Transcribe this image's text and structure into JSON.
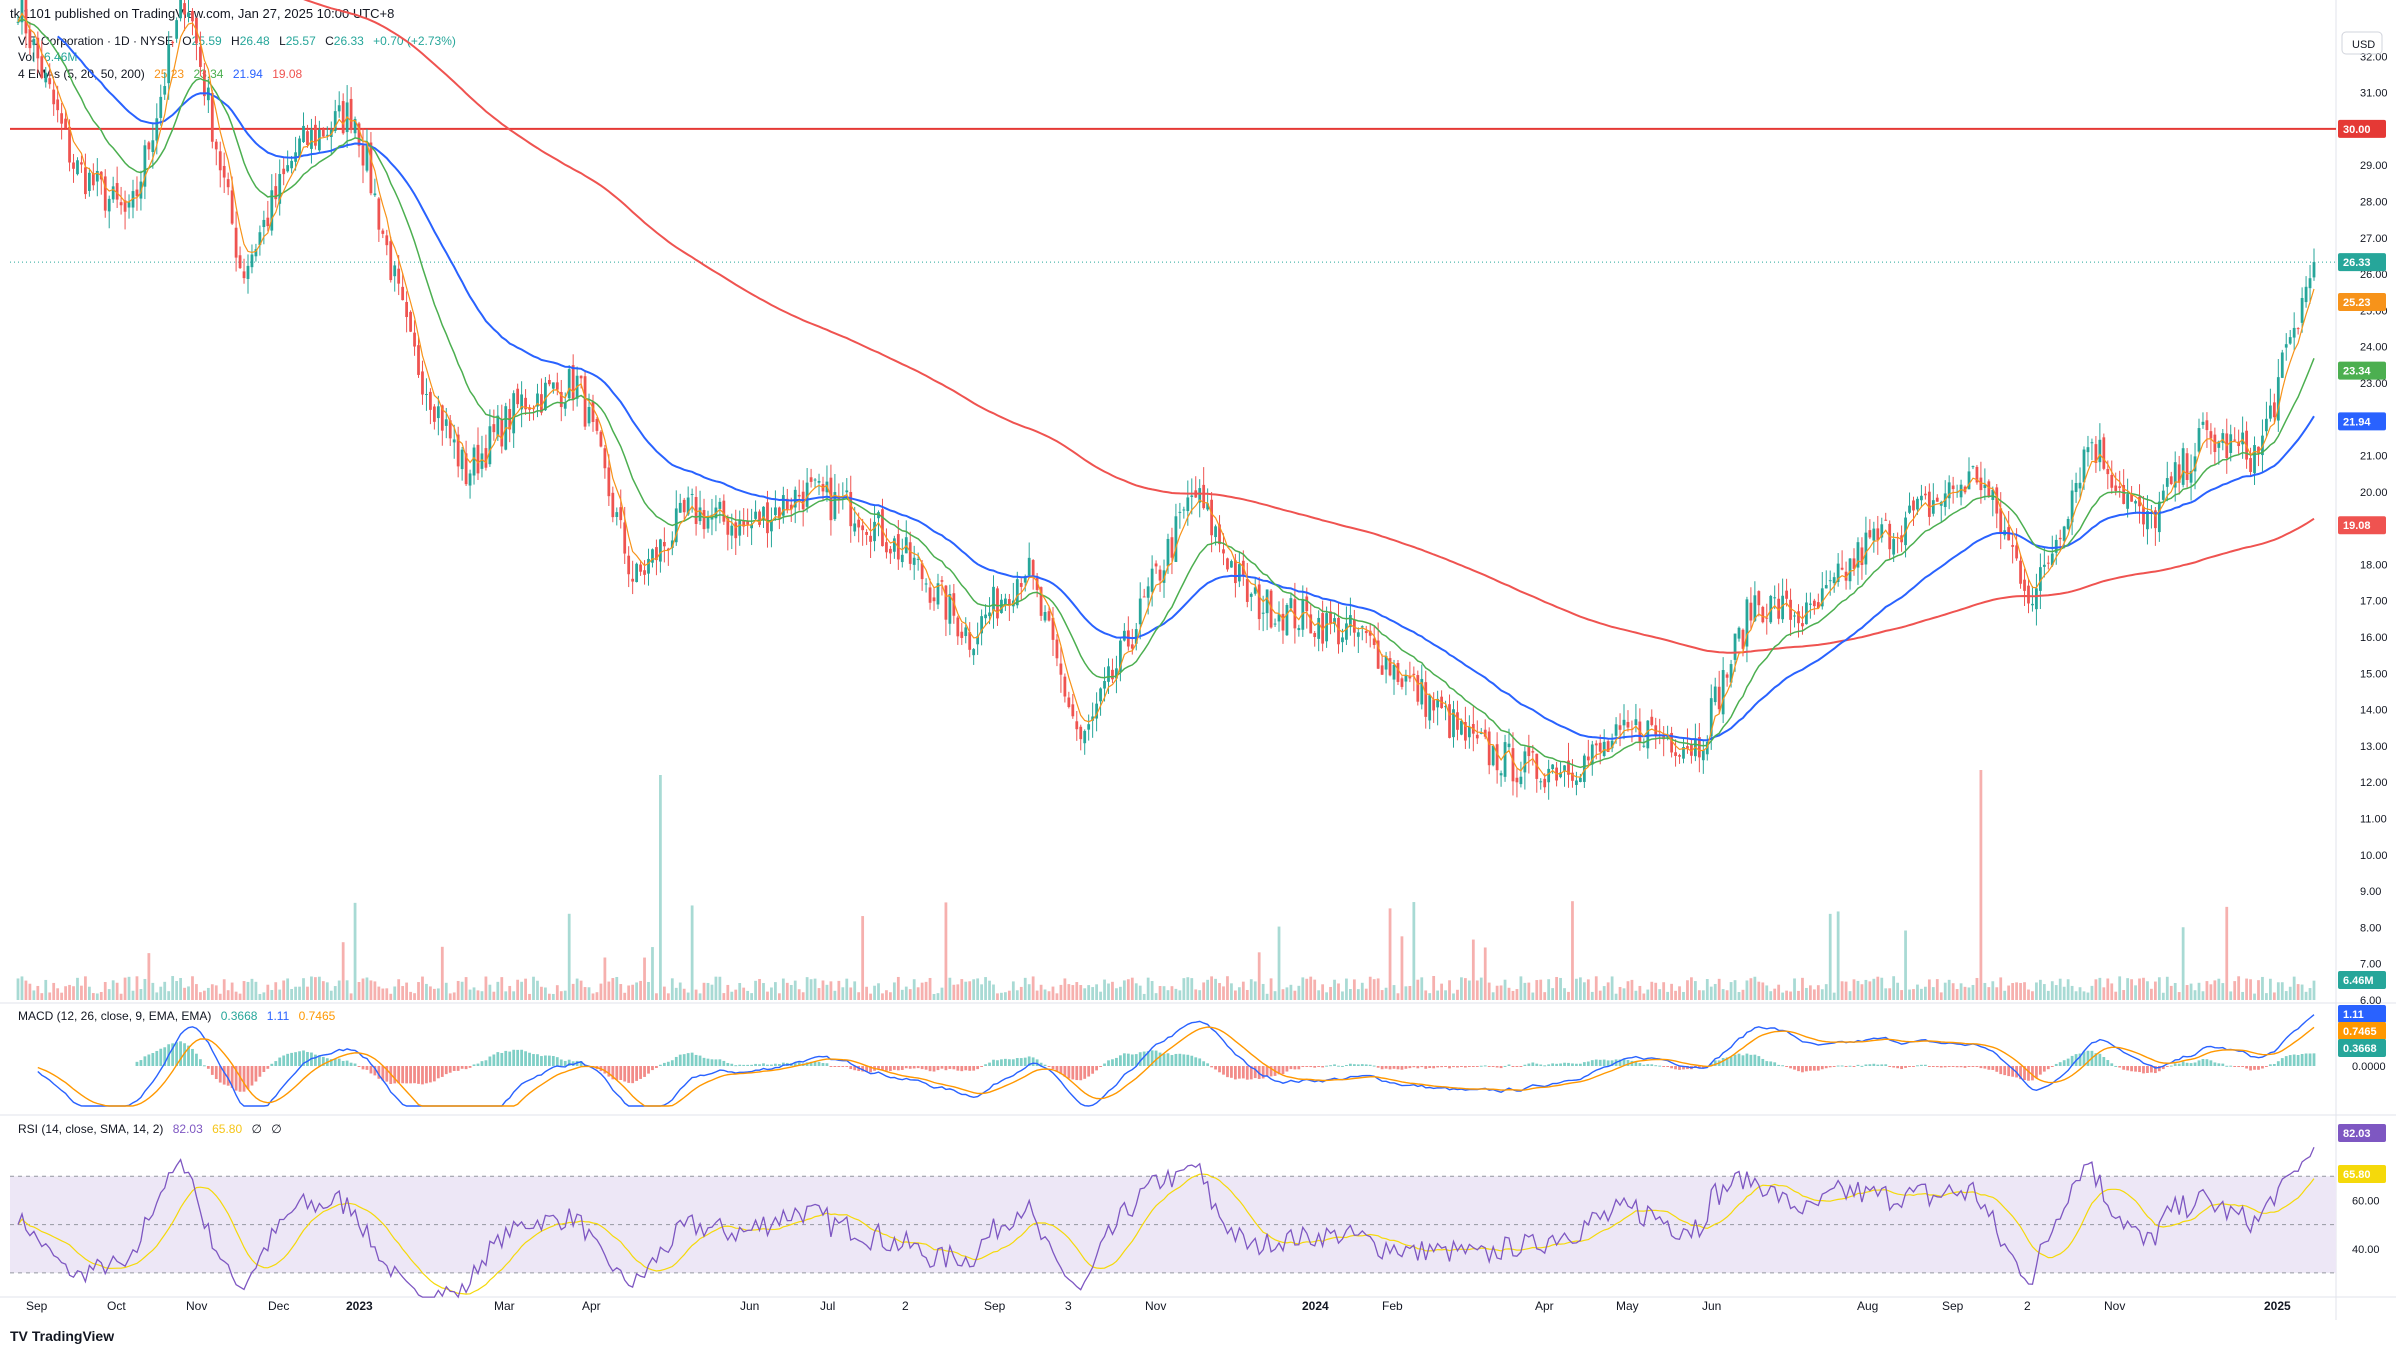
{
  "publisher_line": "tkj1101 published on TradingView.com, Jan 27, 2025 10:00 UTC+8",
  "footer": {
    "logo": "TV",
    "brand": "TradingView"
  },
  "colors": {
    "up": "#26a69a",
    "down": "#ef5350",
    "ema5": "#f7931a",
    "ema20": "#4caf50",
    "ema50": "#2962ff",
    "ema200": "#ef5350",
    "resistance": "#e53935",
    "macd": "#2962ff",
    "signal": "#ff9800",
    "rsi": "#7e57c2",
    "rsi_ma": "#f5d90a",
    "rsi_band": "#ede7f6"
  },
  "legend": {
    "symbol": "V.F. Corporation · 1D · NYSE",
    "o_label": "O",
    "o_val": "25.59",
    "h_label": "H",
    "h_val": "26.48",
    "l_label": "L",
    "l_val": "25.57",
    "c_label": "C",
    "c_val": "26.33",
    "change": "+0.70 (+2.73%)",
    "vol_label": "Vol",
    "vol_val": "6.46M",
    "ema_label": "4 EMAs (5, 20, 50, 200)",
    "ema_vals": [
      "25.23",
      "23.34",
      "21.94",
      "19.08"
    ],
    "macd_label": "MACD (12, 26, close, 9, EMA, EMA)",
    "macd_vals": [
      "0.3668",
      "1.11",
      "0.7465"
    ],
    "rsi_label": "RSI (14, close, SMA, 14, 2)",
    "rsi_vals": [
      "82.03",
      "65.80",
      "∅",
      "∅"
    ]
  },
  "price_axis": {
    "currency": "USD",
    "ticks": [
      "32.00",
      "31.00",
      "29.00",
      "28.00",
      "27.00",
      "26.00",
      "25.00",
      "24.00",
      "23.00",
      "21.00",
      "20.00",
      "18.00",
      "17.00",
      "16.00",
      "15.00",
      "14.00",
      "13.00",
      "12.00",
      "11.00",
      "10.00",
      "9.00",
      "8.00",
      "7.00",
      "6.00"
    ],
    "badges": [
      {
        "label": "30.00",
        "value": 30.0,
        "color": "#e53935"
      },
      {
        "label": "26.33",
        "value": 26.33,
        "color": "#26a69a"
      },
      {
        "label": "25.23",
        "value": 25.23,
        "color": "#f7931a"
      },
      {
        "label": "23.34",
        "value": 23.34,
        "color": "#4caf50"
      },
      {
        "label": "21.94",
        "value": 21.94,
        "color": "#2962ff"
      },
      {
        "label": "19.08",
        "value": 19.08,
        "color": "#ef5350"
      },
      {
        "label": "6.46M",
        "value": 6.2,
        "color": "#26a69a"
      }
    ]
  },
  "macd_axis": {
    "ticks": [
      "0.0000"
    ],
    "badges": [
      {
        "label": "1.11",
        "value": 1.11,
        "color": "#2962ff"
      },
      {
        "label": "0.7465",
        "value": 0.7465,
        "color": "#ff9800"
      },
      {
        "label": "0.3668",
        "value": 0.3668,
        "color": "#26a69a"
      }
    ]
  },
  "rsi_axis": {
    "ticks": [
      "60.00",
      "40.00"
    ],
    "badges": [
      {
        "label": "82.03",
        "value": 82.03,
        "color": "#7e57c2"
      },
      {
        "label": "65.80",
        "value": 65.8,
        "color": "#f5d90a"
      }
    ]
  },
  "time_axis": [
    "Sep",
    "Oct",
    "Nov",
    "Dec",
    "2023",
    "Mar",
    "Apr",
    "Jun",
    "Jul",
    "2",
    "Sep",
    "3",
    "Nov",
    "2024",
    "Feb",
    "Apr",
    "May",
    "Jun",
    "Aug",
    "Sep",
    "2",
    "Nov",
    "2025"
  ],
  "chart_data": {
    "type": "candlestick",
    "title": "V.F. Corporation · 1D · NYSE",
    "ylabel": "USD",
    "ylim": [
      6.0,
      33.0
    ],
    "resistance_level": 30.0,
    "last": {
      "open": 25.59,
      "high": 26.48,
      "low": 25.57,
      "close": 26.33,
      "change": 0.7,
      "change_pct": 2.73,
      "volume": "6.46M"
    },
    "close_path": [
      [
        "Sep",
        33.5
      ],
      [
        "Oct",
        29.0
      ],
      [
        "Nov",
        27.5
      ],
      [
        "Dec",
        33.8
      ],
      [
        "Dec",
        26.0
      ],
      [
        "2023",
        29.5
      ],
      [
        "2023",
        30.5
      ],
      [
        "Mar",
        24.0
      ],
      [
        "Mar",
        20.5
      ],
      [
        "Apr",
        22.5
      ],
      [
        "Apr",
        23.0
      ],
      [
        "Jun",
        17.5
      ],
      [
        "Jun",
        19.5
      ],
      [
        "Jul",
        19.0
      ],
      [
        "2",
        20.0
      ],
      [
        "Sep",
        19.5
      ],
      [
        "Sep",
        18.0
      ],
      [
        "3",
        16.0
      ],
      [
        "Nov",
        18.0
      ],
      [
        "Nov",
        13.0
      ],
      [
        "Nov",
        16.5
      ],
      [
        "Nov",
        20.0
      ],
      [
        "2024",
        17.0
      ],
      [
        "Feb",
        16.5
      ],
      [
        "Feb",
        16.0
      ],
      [
        "Apr",
        14.5
      ],
      [
        "Apr",
        13.0
      ],
      [
        "May",
        12.3
      ],
      [
        "May",
        12.6
      ],
      [
        "Jun",
        13.5
      ],
      [
        "Jun",
        13.0
      ],
      [
        "Aug",
        17.0
      ],
      [
        "Aug",
        16.5
      ],
      [
        "Sep",
        18.5
      ],
      [
        "2",
        19.5
      ],
      [
        "2",
        20.5
      ],
      [
        "Nov",
        17.0
      ],
      [
        "Nov",
        21.5
      ],
      [
        "Nov",
        19.0
      ],
      [
        "2025",
        21.5
      ],
      [
        "2025",
        21.0
      ],
      [
        "2025",
        26.33
      ]
    ],
    "series": [
      {
        "name": "EMA 5",
        "last": 25.23
      },
      {
        "name": "EMA 20",
        "last": 23.34
      },
      {
        "name": "EMA 50",
        "last": 21.94
      },
      {
        "name": "EMA 200",
        "last": 19.08
      }
    ],
    "macd": {
      "macd": 1.11,
      "signal": 0.7465,
      "histogram": 0.3668
    },
    "rsi": {
      "value": 82.03,
      "ma": 65.8,
      "upper": 70,
      "lower": 30
    },
    "grid": false
  }
}
